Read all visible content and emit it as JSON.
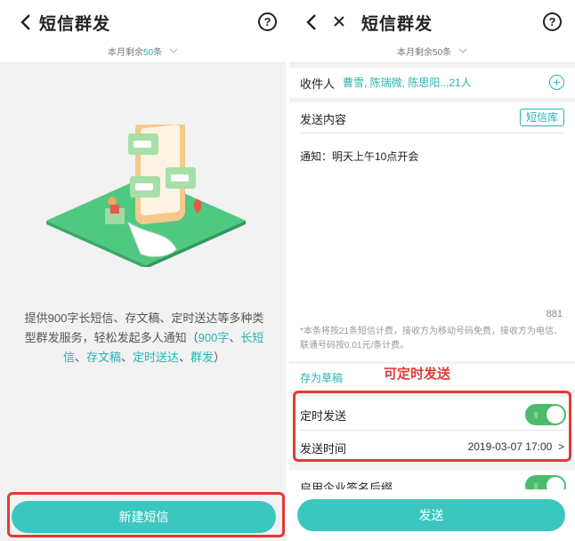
{
  "left": {
    "header": {
      "title": "短信群发",
      "back_icon": "chevron-left-icon",
      "help_icon": "question-circle-icon",
      "help_glyph": "?"
    },
    "quota": {
      "prefix": "本月剩余",
      "count": "50",
      "suffix": "条"
    },
    "intro": {
      "text1": "提供900字长短信、存文稿、定时送达等多种类型群发服务，轻松发起多人通知（",
      "hl1": "900字",
      "sep1": "、",
      "hl2": "长短信",
      "sep2": "、",
      "hl3": "存文稿",
      "sep3": "、",
      "hl4": "定时送达",
      "sep4": "、",
      "hl5": "群发",
      "text2": "）"
    },
    "new_button_label": "新建短信"
  },
  "right": {
    "header": {
      "title": "短信群发",
      "back_icon": "chevron-left-icon",
      "close_icon": "close-icon",
      "help_icon": "question-circle-icon",
      "help_glyph": "?"
    },
    "quota": {
      "prefix": "本月剩余",
      "count": "50",
      "suffix": "条"
    },
    "recipients": {
      "label": "收件人",
      "value": "曹雪, 陈瑞微, 陈思阳...21人",
      "add_glyph": "+"
    },
    "content": {
      "label": "发送内容",
      "library_button": "短信库",
      "message": "通知：明天上午10点开会",
      "char_count": "881"
    },
    "note": "*本条将按21条短信计费，接收方为移动号码免费，接收方为电信、联通号码按0.01元/条计费。",
    "save_draft": "存为草稿",
    "annotation": "可定时发送",
    "scheduled": {
      "label": "定时发送",
      "on": true
    },
    "send_time": {
      "label": "发送时间",
      "value": "2019-03-07 17:00",
      "arrow": ">"
    },
    "signature": {
      "label": "启用企业签名后缀",
      "on": true
    },
    "send_button_label": "发送"
  },
  "colors": {
    "accent": "#26b3b3",
    "button": "#3cc6c0",
    "toggle_on": "#4cbb6c",
    "highlight_box": "#e53935"
  }
}
